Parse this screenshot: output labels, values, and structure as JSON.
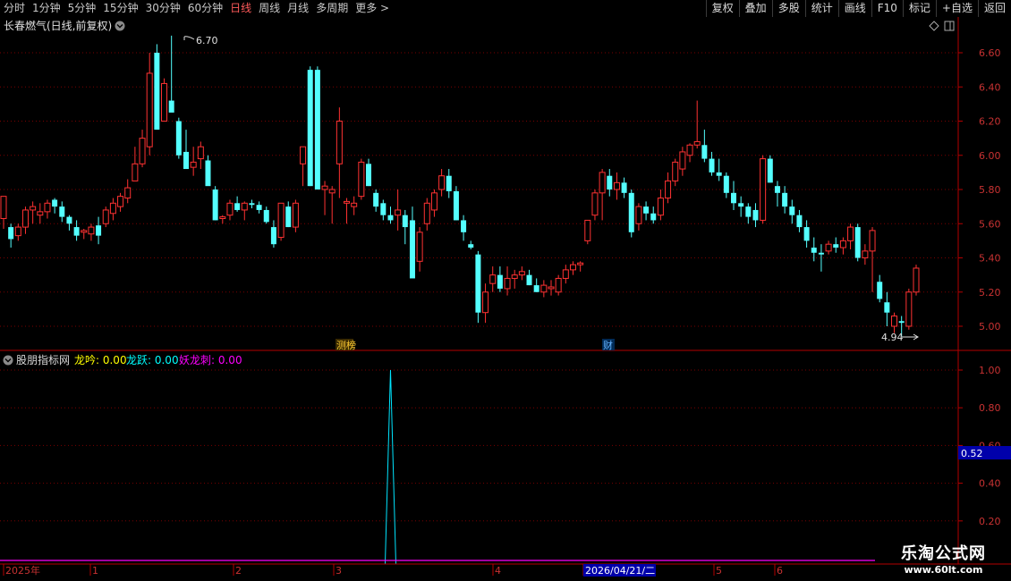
{
  "periods": [
    {
      "label": "分时",
      "active": false
    },
    {
      "label": "1分钟",
      "active": false
    },
    {
      "label": "5分钟",
      "active": false
    },
    {
      "label": "15分钟",
      "active": false
    },
    {
      "label": "30分钟",
      "active": false
    },
    {
      "label": "60分钟",
      "active": false
    },
    {
      "label": "日线",
      "active": true
    },
    {
      "label": "周线",
      "active": false
    },
    {
      "label": "月线",
      "active": false
    },
    {
      "label": "多周期",
      "active": false
    },
    {
      "label": "更多 >",
      "active": false
    }
  ],
  "tools": [
    "复权",
    "叠加",
    "多股",
    "统计",
    "画线",
    "F10",
    "标记",
    "+自选",
    "返回"
  ],
  "stock_title": "长春燃气(日线,前复权)",
  "price_axis": {
    "ticks": [
      "6.60",
      "6.40",
      "6.20",
      "6.00",
      "5.80",
      "5.60",
      "5.40",
      "5.20",
      "5.00"
    ]
  },
  "high_label": "6.70",
  "low_label": "4.94",
  "event_markers": [
    {
      "label": "测榜"
    },
    {
      "label": "财"
    }
  ],
  "indicator": {
    "name": "股朋指标网",
    "params": [
      {
        "label": "龙吟: 0.00",
        "color": "#ffff00"
      },
      {
        "label": "龙跃: 0.00",
        "color": "#00ffff"
      },
      {
        "label": "妖龙刺: 0.00",
        "color": "#ff00ff"
      }
    ],
    "axis_ticks": [
      "1.00",
      "0.80",
      "0.60",
      "0.40",
      "0.20"
    ],
    "current_value": "0.52"
  },
  "time_axis": {
    "labels": [
      "2025年",
      "1",
      "2",
      "3",
      "4",
      "2026/04/21/二",
      "5",
      "6"
    ]
  },
  "watermark": {
    "line1": "乐淘公式网",
    "line2": "www.60lt.com"
  },
  "colors": {
    "up": "#ff3232",
    "down": "#54ffff",
    "grid": "#7a0000",
    "axis_text": "#c83232",
    "indicator_line": "#00e5ff",
    "zero_line": "#ff00ff"
  },
  "chart_data": {
    "type": "candlestick",
    "title": "长春燃气(日线,前复权)",
    "ylim": [
      4.9,
      6.75
    ],
    "indicator_ylim": [
      0,
      1.0
    ],
    "ohlc": [
      [
        5.63,
        5.76,
        5.57,
        5.76
      ],
      [
        5.58,
        5.6,
        5.46,
        5.51
      ],
      [
        5.53,
        5.6,
        5.5,
        5.58
      ],
      [
        5.58,
        5.7,
        5.54,
        5.68
      ],
      [
        5.68,
        5.73,
        5.6,
        5.7
      ],
      [
        5.65,
        5.72,
        5.6,
        5.67
      ],
      [
        5.67,
        5.74,
        5.63,
        5.72
      ],
      [
        5.74,
        5.75,
        5.66,
        5.7
      ],
      [
        5.7,
        5.73,
        5.61,
        5.64
      ],
      [
        5.64,
        5.65,
        5.56,
        5.6
      ],
      [
        5.58,
        5.62,
        5.5,
        5.53
      ],
      [
        5.55,
        5.57,
        5.51,
        5.56
      ],
      [
        5.54,
        5.6,
        5.5,
        5.58
      ],
      [
        5.59,
        5.64,
        5.48,
        5.53
      ],
      [
        5.6,
        5.7,
        5.58,
        5.68
      ],
      [
        5.66,
        5.75,
        5.62,
        5.72
      ],
      [
        5.7,
        5.78,
        5.67,
        5.76
      ],
      [
        5.75,
        5.86,
        5.72,
        5.81
      ],
      [
        5.85,
        6.05,
        5.85,
        5.95
      ],
      [
        5.95,
        6.15,
        5.93,
        6.1
      ],
      [
        6.05,
        6.6,
        6.0,
        6.48
      ],
      [
        6.6,
        6.65,
        6.15,
        6.15
      ],
      [
        6.2,
        6.45,
        6.2,
        6.42
      ],
      [
        6.32,
        6.7,
        6.28,
        6.25
      ],
      [
        6.2,
        6.22,
        5.98,
        6.0
      ],
      [
        6.02,
        6.15,
        5.95,
        5.92
      ],
      [
        5.93,
        6.05,
        5.88,
        5.96
      ],
      [
        5.98,
        6.08,
        5.92,
        6.05
      ],
      [
        5.97,
        6.0,
        5.85,
        5.82
      ],
      [
        5.8,
        5.82,
        5.62,
        5.62
      ],
      [
        5.63,
        5.65,
        5.6,
        5.64
      ],
      [
        5.65,
        5.74,
        5.62,
        5.72
      ],
      [
        5.72,
        5.76,
        5.67,
        5.68
      ],
      [
        5.68,
        5.73,
        5.62,
        5.72
      ],
      [
        5.72,
        5.74,
        5.69,
        5.71
      ],
      [
        5.71,
        5.73,
        5.66,
        5.68
      ],
      [
        5.68,
        5.7,
        5.6,
        5.61
      ],
      [
        5.58,
        5.62,
        5.46,
        5.48
      ],
      [
        5.52,
        5.72,
        5.5,
        5.72
      ],
      [
        5.7,
        5.73,
        5.58,
        5.58
      ],
      [
        5.58,
        5.74,
        5.55,
        5.72
      ],
      [
        5.95,
        6.05,
        5.82,
        6.05
      ],
      [
        6.5,
        6.52,
        5.82,
        5.82
      ],
      [
        6.5,
        6.52,
        5.95,
        5.8
      ],
      [
        5.8,
        5.85,
        5.65,
        5.82
      ],
      [
        5.78,
        5.82,
        5.6,
        5.8
      ],
      [
        5.95,
        6.28,
        5.75,
        6.2
      ],
      [
        5.72,
        5.75,
        5.6,
        5.73
      ],
      [
        5.7,
        5.76,
        5.65,
        5.72
      ],
      [
        5.76,
        5.98,
        5.74,
        5.96
      ],
      [
        5.95,
        5.98,
        5.82,
        5.82
      ],
      [
        5.78,
        5.8,
        5.67,
        5.7
      ],
      [
        5.72,
        5.74,
        5.62,
        5.65
      ],
      [
        5.65,
        5.7,
        5.6,
        5.62
      ],
      [
        5.65,
        5.8,
        5.56,
        5.68
      ],
      [
        5.65,
        5.68,
        5.48,
        5.58
      ],
      [
        5.62,
        5.7,
        5.46,
        5.28
      ],
      [
        5.38,
        5.58,
        5.32,
        5.55
      ],
      [
        5.6,
        5.75,
        5.56,
        5.72
      ],
      [
        5.68,
        5.8,
        5.64,
        5.78
      ],
      [
        5.8,
        5.92,
        5.76,
        5.88
      ],
      [
        5.88,
        5.92,
        5.75,
        5.79
      ],
      [
        5.79,
        5.82,
        5.62,
        5.62
      ],
      [
        5.62,
        5.65,
        5.5,
        5.55
      ],
      [
        5.48,
        5.5,
        5.45,
        5.46
      ],
      [
        5.42,
        5.44,
        5.02,
        5.08
      ],
      [
        5.08,
        5.25,
        5.02,
        5.2
      ],
      [
        5.25,
        5.35,
        5.2,
        5.3
      ],
      [
        5.3,
        5.35,
        5.2,
        5.22
      ],
      [
        5.22,
        5.35,
        5.18,
        5.28
      ],
      [
        5.28,
        5.33,
        5.22,
        5.3
      ],
      [
        5.3,
        5.35,
        5.27,
        5.32
      ],
      [
        5.3,
        5.33,
        5.24,
        5.24
      ],
      [
        5.24,
        5.28,
        5.2,
        5.2
      ],
      [
        5.2,
        5.27,
        5.17,
        5.24
      ],
      [
        5.22,
        5.27,
        5.18,
        5.23
      ],
      [
        5.2,
        5.3,
        5.18,
        5.28
      ],
      [
        5.28,
        5.36,
        5.25,
        5.33
      ],
      [
        5.33,
        5.38,
        5.3,
        5.36
      ],
      [
        5.36,
        5.38,
        5.32,
        5.37
      ],
      [
        5.5,
        5.62,
        5.48,
        5.62
      ],
      [
        5.65,
        5.8,
        5.62,
        5.78
      ],
      [
        5.78,
        5.92,
        5.62,
        5.9
      ],
      [
        5.88,
        5.92,
        5.76,
        5.8
      ],
      [
        5.8,
        5.9,
        5.74,
        5.84
      ],
      [
        5.84,
        5.87,
        5.75,
        5.78
      ],
      [
        5.78,
        5.8,
        5.52,
        5.55
      ],
      [
        5.6,
        5.72,
        5.56,
        5.7
      ],
      [
        5.7,
        5.73,
        5.62,
        5.66
      ],
      [
        5.66,
        5.7,
        5.6,
        5.62
      ],
      [
        5.65,
        5.8,
        5.62,
        5.75
      ],
      [
        5.75,
        5.9,
        5.72,
        5.85
      ],
      [
        5.85,
        5.98,
        5.82,
        5.96
      ],
      [
        5.92,
        6.05,
        5.88,
        6.02
      ],
      [
        6.0,
        6.07,
        5.96,
        6.06
      ],
      [
        6.06,
        6.32,
        6.04,
        6.08
      ],
      [
        6.06,
        6.15,
        5.96,
        5.98
      ],
      [
        5.98,
        6.02,
        5.88,
        5.9
      ],
      [
        5.9,
        5.98,
        5.85,
        5.88
      ],
      [
        5.88,
        5.9,
        5.75,
        5.78
      ],
      [
        5.78,
        5.85,
        5.68,
        5.72
      ],
      [
        5.72,
        5.76,
        5.64,
        5.7
      ],
      [
        5.7,
        5.72,
        5.6,
        5.64
      ],
      [
        5.68,
        5.72,
        5.58,
        5.62
      ],
      [
        5.62,
        6.0,
        5.6,
        5.98
      ],
      [
        5.98,
        6.0,
        5.84,
        5.84
      ],
      [
        5.82,
        5.85,
        5.7,
        5.78
      ],
      [
        5.78,
        5.82,
        5.66,
        5.7
      ],
      [
        5.7,
        5.74,
        5.6,
        5.65
      ],
      [
        5.65,
        5.68,
        5.55,
        5.58
      ],
      [
        5.58,
        5.62,
        5.46,
        5.5
      ],
      [
        5.46,
        5.52,
        5.38,
        5.43
      ],
      [
        5.43,
        5.48,
        5.32,
        5.42
      ],
      [
        5.44,
        5.5,
        5.42,
        5.48
      ],
      [
        5.48,
        5.52,
        5.43,
        5.46
      ],
      [
        5.46,
        5.52,
        5.42,
        5.5
      ],
      [
        5.5,
        5.6,
        5.45,
        5.58
      ],
      [
        5.58,
        5.6,
        5.38,
        5.4
      ],
      [
        5.4,
        5.48,
        5.36,
        5.44
      ],
      [
        5.44,
        5.58,
        5.2,
        5.56
      ],
      [
        5.26,
        5.3,
        5.14,
        5.16
      ],
      [
        5.14,
        5.2,
        5.0,
        5.08
      ],
      [
        5.0,
        5.08,
        4.96,
        5.06
      ],
      [
        5.03,
        5.06,
        4.94,
        5.02
      ],
      [
        5.0,
        5.22,
        4.98,
        5.2
      ],
      [
        5.2,
        5.36,
        5.18,
        5.34
      ]
    ],
    "indicator_series": {
      "name": "龙跃",
      "spike_index": 53,
      "spike_value": 1.0
    }
  }
}
